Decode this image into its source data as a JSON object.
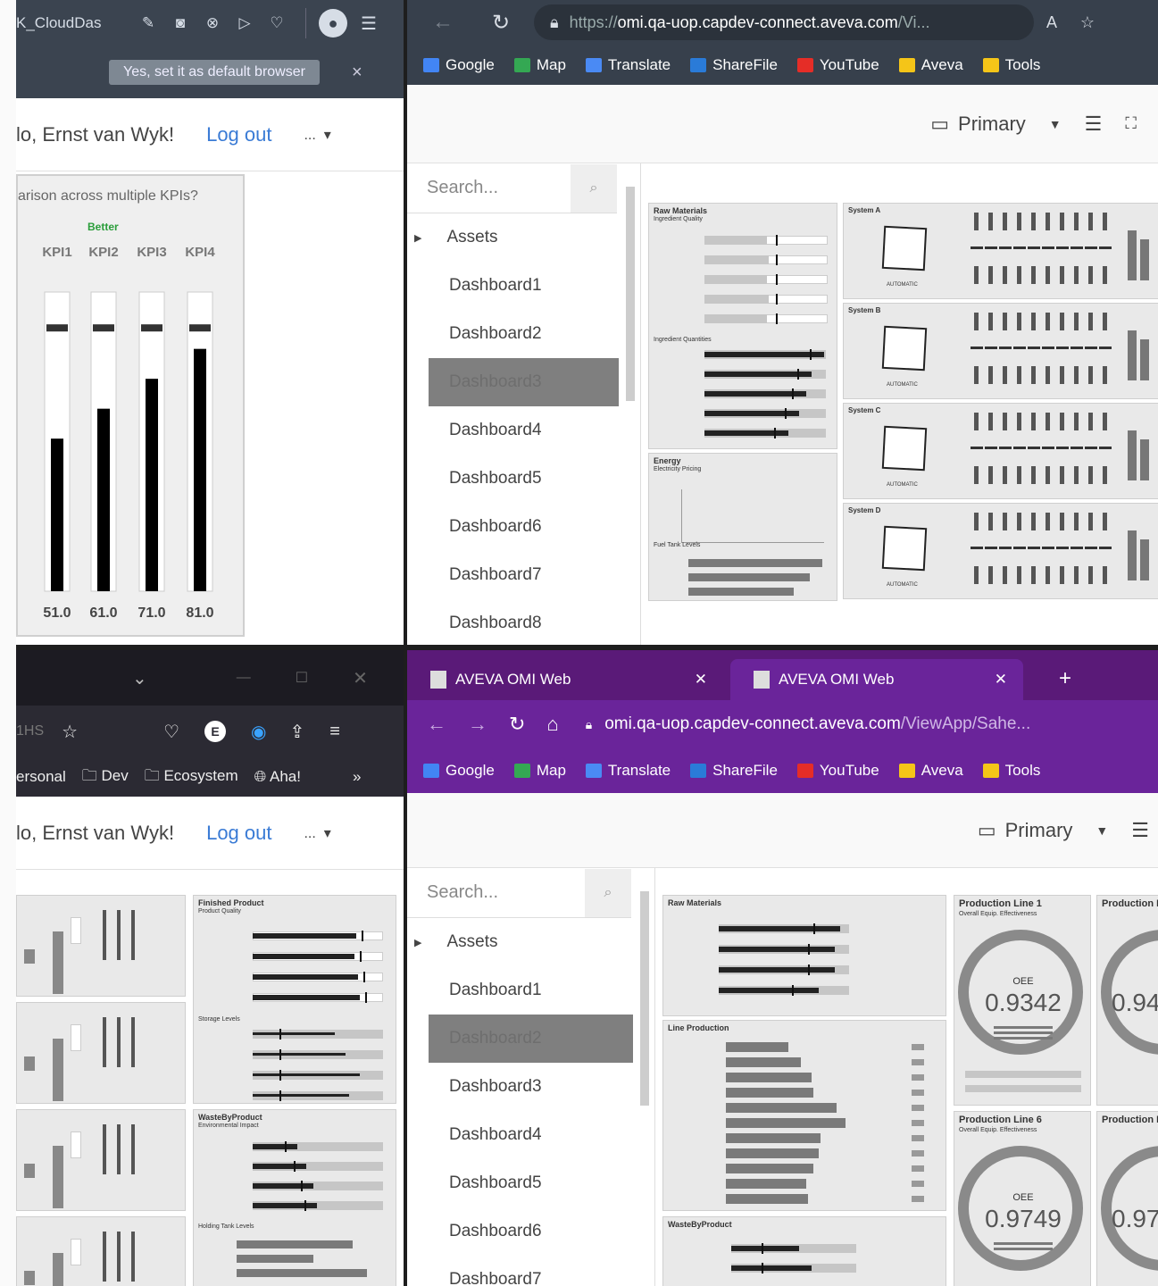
{
  "tl": {
    "app_title": "K_CloudDas",
    "default_prompt": "Yes, set it as default browser",
    "close": "×",
    "greeting": "lo, Ernst van Wyk!",
    "logout": "Log out",
    "more": "...",
    "chart_question": "arison across multiple KPIs?",
    "better": "Better"
  },
  "chart_data": {
    "type": "bar",
    "categories": [
      "KPI1",
      "KPI2",
      "KPI3",
      "KPI4"
    ],
    "values": [
      51.0,
      61.0,
      71.0,
      81.0
    ],
    "value_labels": [
      "51.0",
      "61.0",
      "71.0",
      "81.0"
    ],
    "target": 88,
    "ylim": [
      0,
      100
    ]
  },
  "tr": {
    "url_prefix": "https://",
    "url_host": "omi.qa-uop.capdev-connect.aveva.com",
    "url_rest": "/Vi...",
    "bookmarks": [
      "Google",
      "Map",
      "Translate",
      "ShareFile",
      "YouTube",
      "Aveva",
      "Tools"
    ],
    "display": "Primary",
    "search_placeholder": "Search...",
    "assets": "Assets",
    "nav": [
      "Dashboard1",
      "Dashboard2",
      "Dashboard3",
      "Dashboard4",
      "Dashboard5",
      "Dashboard6",
      "Dashboard7",
      "Dashboard8"
    ],
    "raw_materials": "Raw Materials",
    "ingredient_quality": "Ingredient Quality",
    "ingredient_quantities": "Ingredient Quantities",
    "energy": "Energy",
    "electricity_pricing": "Electricity Pricing",
    "fuel_tank_levels": "Fuel Tank Levels",
    "systems": [
      "System A",
      "System B",
      "System C",
      "System D"
    ],
    "automatic": "AUTOMATIC"
  },
  "bl": {
    "tab_text": "1HS",
    "bookmarks": [
      "ersonal",
      "Dev",
      "Ecosystem",
      "Aha!"
    ],
    "greeting": "lo, Ernst van Wyk!",
    "logout": "Log out",
    "more": "...",
    "finished_product": "Finished Product",
    "product_quality": "Product Quality",
    "storage_levels": "Storage Levels",
    "waste": "WasteByProduct",
    "env_impact": "Environmental Impact",
    "holding_tank": "Holding Tank Levels"
  },
  "br": {
    "tabs": [
      "AVEVA OMI Web",
      "AVEVA OMI Web"
    ],
    "url_host": "omi.qa-uop.capdev-connect.aveva.com",
    "url_rest": "/ViewApp/Sahe...",
    "bookmarks": [
      "Google",
      "Map",
      "Translate",
      "ShareFile",
      "YouTube",
      "Aveva",
      "Tools"
    ],
    "display": "Primary",
    "search_placeholder": "Search...",
    "assets": "Assets",
    "nav": [
      "Dashboard1",
      "Dashboard2",
      "Dashboard3",
      "Dashboard4",
      "Dashboard5",
      "Dashboard6",
      "Dashboard7"
    ],
    "raw_materials": "Raw Materials",
    "line_production": "Line Production",
    "waste": "WasteByProduct",
    "line1": "Production Line 1",
    "line1b": "Production L",
    "line6": "Production Line 6",
    "line6b": "Production L",
    "oee_caption": "Overall Equip. Effectiveness",
    "oee": "OEE",
    "oee1": "0.9342",
    "oee1b": "0.94",
    "oee6": "0.9749",
    "oee6b": "0.97"
  },
  "colors": {
    "purple_tabbar": "#5a1a78",
    "purple_bar": "#6a249a",
    "dark_header": "#3b4450",
    "link": "#3a7bd5"
  }
}
